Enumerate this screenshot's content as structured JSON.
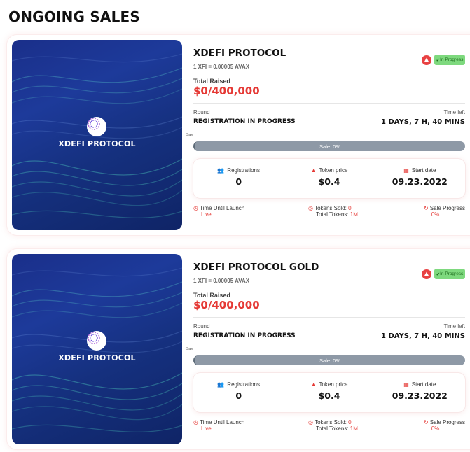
{
  "page": {
    "title": "ONGOING SALES"
  },
  "sales": [
    {
      "banner_name": "XDEFI PROTOCOL",
      "name": "XDEFI PROTOCOL",
      "rate": "1 XFI = 0.00005 AVAX",
      "raised_label": "Total Raised",
      "raised_value": "$0/400,000",
      "status": "In Progress",
      "round_label": "Round",
      "round_value": "REGISTRATION IN PROGRESS",
      "time_label": "Time left",
      "time_value": "1 DAYS, 7 H, 40 MINS",
      "sale_tiny": "Sale",
      "progress_text": "Sale: 0%",
      "progress_fraction": 0,
      "stats": [
        {
          "label": "Registrations",
          "value": "0",
          "icon": "users-icon"
        },
        {
          "label": "Token price",
          "value": "$0.4",
          "icon": "tag-icon"
        },
        {
          "label": "Start date",
          "value": "09.23.2022",
          "icon": "calendar-icon"
        }
      ],
      "launch_label": "Time Until Launch",
      "launch_value": "Live",
      "tokens_sold_label": "Tokens Sold:",
      "tokens_sold_value": "0",
      "total_tokens_label": "Total Tokens:",
      "total_tokens_value": "1M",
      "sale_progress_label": "Sale Progress",
      "sale_progress_value": "0%"
    },
    {
      "banner_name": "XDEFI PROTOCOL",
      "name": "XDEFI PROTOCOL GOLD",
      "rate": "1 XFI = 0.00005 AVAX",
      "raised_label": "Total Raised",
      "raised_value": "$0/400,000",
      "status": "In Progress",
      "round_label": "Round",
      "round_value": "REGISTRATION IN PROGRESS",
      "time_label": "Time left",
      "time_value": "1 DAYS, 7 H, 40 MINS",
      "sale_tiny": "Sale",
      "progress_text": "Sale: 0%",
      "progress_fraction": 0,
      "stats": [
        {
          "label": "Registrations",
          "value": "0",
          "icon": "users-icon"
        },
        {
          "label": "Token price",
          "value": "$0.4",
          "icon": "tag-icon"
        },
        {
          "label": "Start date",
          "value": "09.23.2022",
          "icon": "calendar-icon"
        }
      ],
      "launch_label": "Time Until Launch",
      "launch_value": "Live",
      "tokens_sold_label": "Tokens Sold:",
      "tokens_sold_value": "0",
      "total_tokens_label": "Total Tokens:",
      "total_tokens_value": "1M",
      "sale_progress_label": "Sale Progress",
      "sale_progress_value": "0%"
    }
  ],
  "colors": {
    "accent": "#e53935",
    "badge": "#7ed97e",
    "progress": "#8e99a6",
    "banner": "#1d3a9a"
  }
}
